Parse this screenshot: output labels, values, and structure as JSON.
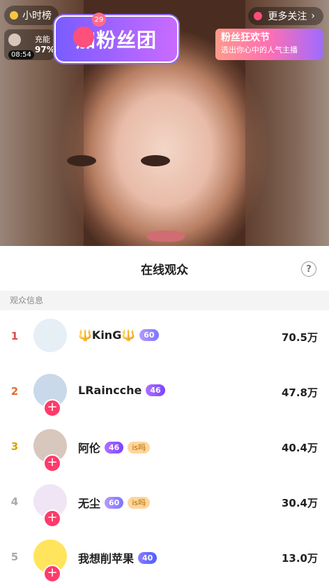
{
  "live": {
    "rank_label": "小时榜",
    "more_follow_label": "更多关注",
    "charge_label": "充能",
    "charge_percent": "97%",
    "time": "08:54",
    "fan_badge_count": "29",
    "fan_group_text": "加粉丝团",
    "carnival_title": "粉丝狂欢节",
    "carnival_subtitle": "选出你心中的人气主播"
  },
  "panel": {
    "title": "在线观众",
    "help_icon": "question-circle-icon",
    "section_label": "观众信息",
    "viewers": [
      {
        "rank": "1",
        "name": "🔱KinG🔱",
        "badge": "60",
        "extra": "",
        "amount": "70.5万"
      },
      {
        "rank": "2",
        "name": "LRaincche",
        "badge": "46",
        "extra": "",
        "amount": "47.8万"
      },
      {
        "rank": "3",
        "name": "阿伦",
        "badge": "46",
        "extra": "is吗",
        "amount": "40.4万"
      },
      {
        "rank": "4",
        "name": "无尘",
        "badge": "60",
        "extra": "is吗",
        "amount": "30.4万"
      },
      {
        "rank": "5",
        "name": "我想削苹果",
        "badge": "40",
        "extra": "",
        "amount": "13.0万"
      }
    ]
  }
}
